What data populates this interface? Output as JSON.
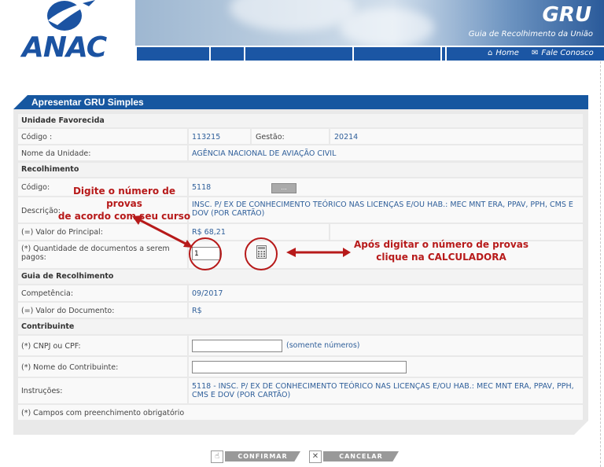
{
  "header": {
    "logo_text": "ANAC",
    "title": "GRU",
    "subtitle": "Guia de Recolhimento da União",
    "nav": [
      {
        "icon": "home-icon",
        "label": "Home"
      },
      {
        "icon": "mail-icon",
        "label": "Fale Conosco"
      }
    ]
  },
  "panel": {
    "title": "Apresentar GRU Simples"
  },
  "unidade": {
    "section": "Unidade Favorecida",
    "codigo_label": "Código :",
    "codigo_value": "113215",
    "gestao_label": "Gestão:",
    "gestao_value": "20214",
    "nome_label": "Nome da Unidade:",
    "nome_value": "AGÊNCIA NACIONAL DE AVIAÇÃO CIVIL"
  },
  "recolhimento": {
    "section": "Recolhimento",
    "codigo_label": "Código:",
    "codigo_value": "5118",
    "lookup_button": "...",
    "descricao_label": "Descrição:",
    "descricao_value": "INSC. P/ EX DE CONHECIMENTO TEÓRICO NAS LICENÇAS E/OU HAB.: MEC MNT ERA, PPAV, PPH, CMS E DOV (POR CARTÃO)",
    "principal_label": "(=) Valor do Principal:",
    "principal_value": "R$ 68,21",
    "quantidade_label": "(*) Quantidade de documentos a serem pagos:",
    "quantidade_value": "1"
  },
  "guia": {
    "section": "Guia de Recolhimento",
    "competencia_label": "Competência:",
    "competencia_value": "09/2017",
    "valor_doc_label": "(=) Valor do Documento:",
    "valor_doc_value": "R$"
  },
  "contribuinte": {
    "section": "Contribuinte",
    "cnpj_label": "(*) CNPJ ou CPF:",
    "cnpj_value": "",
    "cnpj_hint": "(somente números)",
    "nome_label": "(*) Nome do Contribuinte:",
    "nome_value": "",
    "instrucoes_label": "Instruções:",
    "instrucoes_value": "5118  -  INSC. P/ EX DE CONHECIMENTO TEÓRICO NAS LICENÇAS E/OU HAB.: MEC MNT ERA, PPAV, PPH, CMS E DOV (POR CARTÃO)"
  },
  "footer_note": "(*) Campos com preenchimento obrigatório",
  "annotations": {
    "left_line1": "Digite o número de provas",
    "left_line2": "de acordo com seu curso",
    "right_line1": "Após digitar o número de provas",
    "right_line2": "clique na CALCULADORA"
  },
  "buttons": {
    "confirm": "CONFIRMAR",
    "cancel": "CANCELAR"
  },
  "colors": {
    "brand_blue": "#1657a0",
    "annotation_red": "#b71a1a"
  }
}
